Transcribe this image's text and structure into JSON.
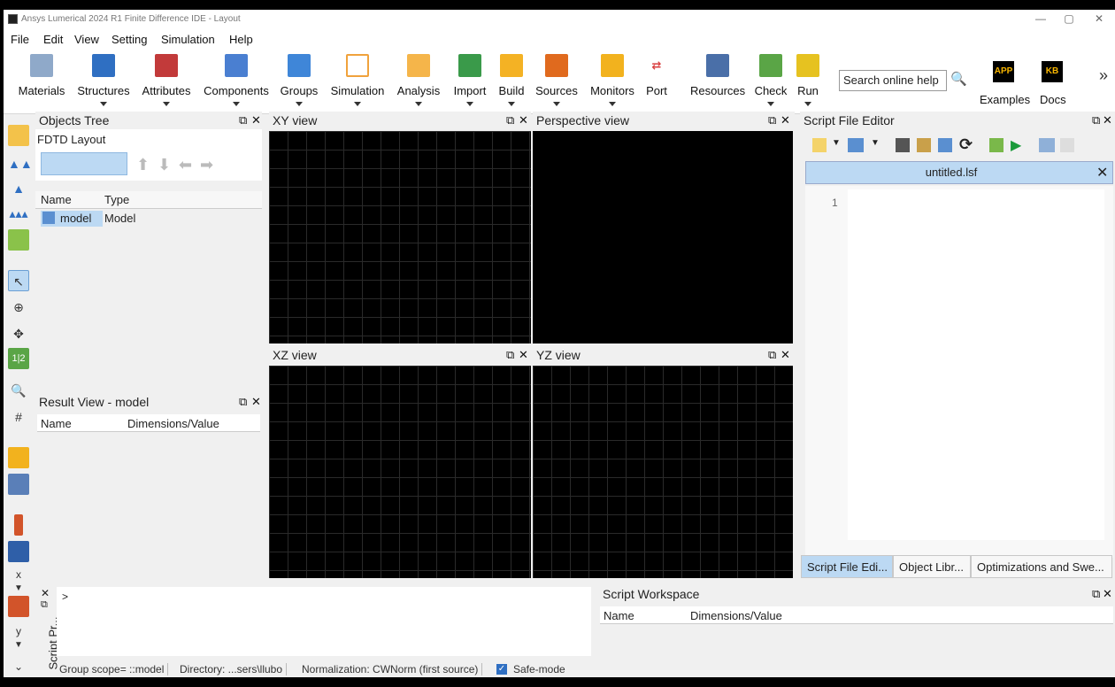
{
  "window": {
    "title": "Ansys Lumerical 2024 R1 Finite Difference IDE - Layout",
    "min": "—",
    "max": "▢",
    "close": "✕"
  },
  "menu": [
    "File",
    "Edit",
    "View",
    "Setting",
    "Simulation",
    "Help"
  ],
  "toolbar": {
    "items": [
      {
        "label": "Materials",
        "icon": "materials-icon",
        "color": "#8fa9c9"
      },
      {
        "label": "Structures",
        "icon": "structures-icon",
        "color": "#2f6fc2"
      },
      {
        "label": "Attributes",
        "icon": "attributes-icon",
        "color": "#c23a3a"
      },
      {
        "label": "Components",
        "icon": "components-icon",
        "color": "#4a7fd1"
      },
      {
        "label": "Groups",
        "icon": "groups-icon",
        "color": "#3f86d8"
      },
      {
        "label": "Simulation",
        "icon": "simulation-icon",
        "color": "#f0a23c"
      },
      {
        "label": "Analysis",
        "icon": "analysis-icon",
        "color": "#f5b54a"
      },
      {
        "label": "Import",
        "icon": "import-icon",
        "color": "#3a9a4a"
      },
      {
        "label": "Build",
        "icon": "build-icon",
        "color": "#f4b224"
      },
      {
        "label": "Sources",
        "icon": "sources-icon",
        "color": "#e06a1e"
      },
      {
        "label": "Monitors",
        "icon": "monitors-icon",
        "color": "#f2b21e"
      },
      {
        "label": "Port",
        "icon": "port-icon",
        "color": "#d94040"
      },
      {
        "label": "Resources",
        "icon": "resources-icon",
        "color": "#4a6fa8"
      },
      {
        "label": "Check",
        "icon": "check-icon",
        "color": "#5aa546"
      },
      {
        "label": "Run",
        "icon": "run-icon",
        "color": "#e6c220"
      }
    ],
    "search_placeholder": "Search online help",
    "examples": {
      "badge": "APP",
      "label": "Examples"
    },
    "docs": {
      "badge": "KB",
      "label": "Docs"
    },
    "more": "»"
  },
  "objects_tree": {
    "title": "Objects Tree",
    "subtitle": "FDTD Layout",
    "col_name": "Name",
    "col_type": "Type",
    "rows": [
      {
        "name": "model",
        "type": "Model"
      }
    ]
  },
  "result_view": {
    "title": "Result View - model",
    "col_name": "Name",
    "col_dims": "Dimensions/Value"
  },
  "views": {
    "xy": "XY view",
    "perspective": "Perspective view",
    "xz": "XZ view",
    "yz": "YZ view"
  },
  "script_editor": {
    "title": "Script File Editor",
    "file_tab": "untitled.lsf",
    "line1": "1"
  },
  "bottom_tabs": [
    "Script File Edi...",
    "Object Libr...",
    "Optimizations and Swe..."
  ],
  "script_prompt": {
    "vertical_title": "Script Pr...",
    "prompt": ">"
  },
  "script_workspace": {
    "title": "Script Workspace",
    "col_name": "Name",
    "col_dims": "Dimensions/Value"
  },
  "status": {
    "scope": "Group scope= ::model",
    "directory": "Directory: ...sers\\llubo",
    "normalization": "Normalization: CWNorm (first source)",
    "safemode": "Safe-mode"
  },
  "panel_controls": {
    "float": "⧉",
    "close": "✕"
  },
  "left_tools": {
    "x_label": "x",
    "y_label": "y"
  }
}
